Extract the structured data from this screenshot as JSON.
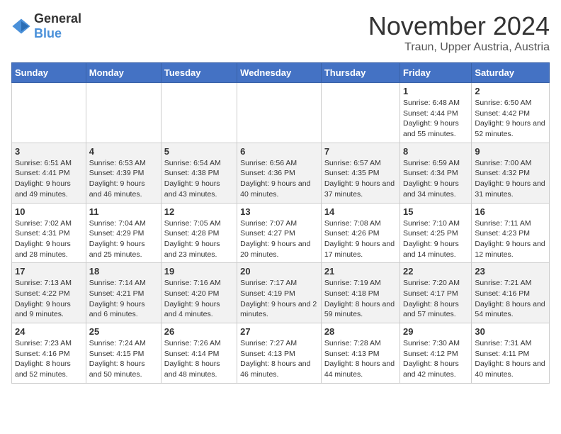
{
  "logo": {
    "text_general": "General",
    "text_blue": "Blue"
  },
  "header": {
    "month": "November 2024",
    "location": "Traun, Upper Austria, Austria"
  },
  "days_of_week": [
    "Sunday",
    "Monday",
    "Tuesday",
    "Wednesday",
    "Thursday",
    "Friday",
    "Saturday"
  ],
  "weeks": [
    [
      {
        "day": "",
        "info": ""
      },
      {
        "day": "",
        "info": ""
      },
      {
        "day": "",
        "info": ""
      },
      {
        "day": "",
        "info": ""
      },
      {
        "day": "",
        "info": ""
      },
      {
        "day": "1",
        "info": "Sunrise: 6:48 AM\nSunset: 4:44 PM\nDaylight: 9 hours and 55 minutes."
      },
      {
        "day": "2",
        "info": "Sunrise: 6:50 AM\nSunset: 4:42 PM\nDaylight: 9 hours and 52 minutes."
      }
    ],
    [
      {
        "day": "3",
        "info": "Sunrise: 6:51 AM\nSunset: 4:41 PM\nDaylight: 9 hours and 49 minutes."
      },
      {
        "day": "4",
        "info": "Sunrise: 6:53 AM\nSunset: 4:39 PM\nDaylight: 9 hours and 46 minutes."
      },
      {
        "day": "5",
        "info": "Sunrise: 6:54 AM\nSunset: 4:38 PM\nDaylight: 9 hours and 43 minutes."
      },
      {
        "day": "6",
        "info": "Sunrise: 6:56 AM\nSunset: 4:36 PM\nDaylight: 9 hours and 40 minutes."
      },
      {
        "day": "7",
        "info": "Sunrise: 6:57 AM\nSunset: 4:35 PM\nDaylight: 9 hours and 37 minutes."
      },
      {
        "day": "8",
        "info": "Sunrise: 6:59 AM\nSunset: 4:34 PM\nDaylight: 9 hours and 34 minutes."
      },
      {
        "day": "9",
        "info": "Sunrise: 7:00 AM\nSunset: 4:32 PM\nDaylight: 9 hours and 31 minutes."
      }
    ],
    [
      {
        "day": "10",
        "info": "Sunrise: 7:02 AM\nSunset: 4:31 PM\nDaylight: 9 hours and 28 minutes."
      },
      {
        "day": "11",
        "info": "Sunrise: 7:04 AM\nSunset: 4:29 PM\nDaylight: 9 hours and 25 minutes."
      },
      {
        "day": "12",
        "info": "Sunrise: 7:05 AM\nSunset: 4:28 PM\nDaylight: 9 hours and 23 minutes."
      },
      {
        "day": "13",
        "info": "Sunrise: 7:07 AM\nSunset: 4:27 PM\nDaylight: 9 hours and 20 minutes."
      },
      {
        "day": "14",
        "info": "Sunrise: 7:08 AM\nSunset: 4:26 PM\nDaylight: 9 hours and 17 minutes."
      },
      {
        "day": "15",
        "info": "Sunrise: 7:10 AM\nSunset: 4:25 PM\nDaylight: 9 hours and 14 minutes."
      },
      {
        "day": "16",
        "info": "Sunrise: 7:11 AM\nSunset: 4:23 PM\nDaylight: 9 hours and 12 minutes."
      }
    ],
    [
      {
        "day": "17",
        "info": "Sunrise: 7:13 AM\nSunset: 4:22 PM\nDaylight: 9 hours and 9 minutes."
      },
      {
        "day": "18",
        "info": "Sunrise: 7:14 AM\nSunset: 4:21 PM\nDaylight: 9 hours and 6 minutes."
      },
      {
        "day": "19",
        "info": "Sunrise: 7:16 AM\nSunset: 4:20 PM\nDaylight: 9 hours and 4 minutes."
      },
      {
        "day": "20",
        "info": "Sunrise: 7:17 AM\nSunset: 4:19 PM\nDaylight: 9 hours and 2 minutes."
      },
      {
        "day": "21",
        "info": "Sunrise: 7:19 AM\nSunset: 4:18 PM\nDaylight: 8 hours and 59 minutes."
      },
      {
        "day": "22",
        "info": "Sunrise: 7:20 AM\nSunset: 4:17 PM\nDaylight: 8 hours and 57 minutes."
      },
      {
        "day": "23",
        "info": "Sunrise: 7:21 AM\nSunset: 4:16 PM\nDaylight: 8 hours and 54 minutes."
      }
    ],
    [
      {
        "day": "24",
        "info": "Sunrise: 7:23 AM\nSunset: 4:16 PM\nDaylight: 8 hours and 52 minutes."
      },
      {
        "day": "25",
        "info": "Sunrise: 7:24 AM\nSunset: 4:15 PM\nDaylight: 8 hours and 50 minutes."
      },
      {
        "day": "26",
        "info": "Sunrise: 7:26 AM\nSunset: 4:14 PM\nDaylight: 8 hours and 48 minutes."
      },
      {
        "day": "27",
        "info": "Sunrise: 7:27 AM\nSunset: 4:13 PM\nDaylight: 8 hours and 46 minutes."
      },
      {
        "day": "28",
        "info": "Sunrise: 7:28 AM\nSunset: 4:13 PM\nDaylight: 8 hours and 44 minutes."
      },
      {
        "day": "29",
        "info": "Sunrise: 7:30 AM\nSunset: 4:12 PM\nDaylight: 8 hours and 42 minutes."
      },
      {
        "day": "30",
        "info": "Sunrise: 7:31 AM\nSunset: 4:11 PM\nDaylight: 8 hours and 40 minutes."
      }
    ]
  ]
}
